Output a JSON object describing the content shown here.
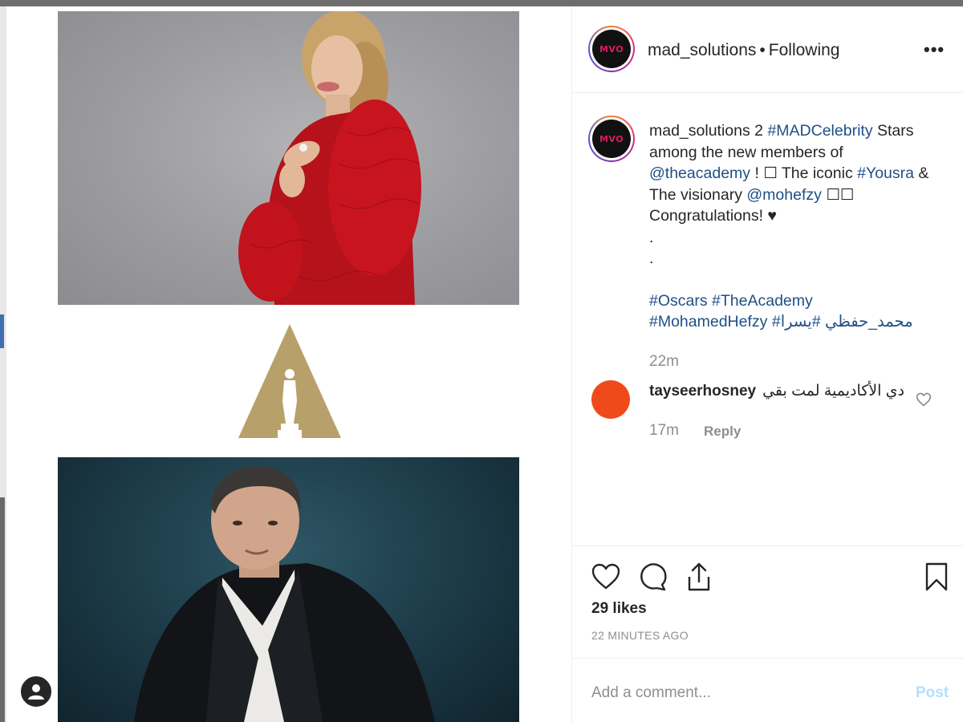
{
  "header": {
    "username": "mad_solutions",
    "separator": "•",
    "follow_status": "Following",
    "more": "•••",
    "avatar_text": "MVO"
  },
  "caption": {
    "username": "mad_solutions",
    "text_1": "2",
    "tag_1": "#MADCelebrity",
    "text_2": "Stars among the new members of",
    "mention_1": "@theacademy",
    "text_3": "! ☐ The iconic",
    "tag_2": "#Yousra",
    "text_4": "& The visionary",
    "mention_2": "@mohefzy",
    "text_5": "☐☐",
    "text_6": "Congratulations! ♥",
    "dot_1": ".",
    "dot_2": ".",
    "tag_3": "#Oscars",
    "tag_4": "#TheAcademy",
    "tag_5": "#MohamedHefzy",
    "tag_6": "#محمد_حفظي",
    "tag_7": "#يسرا",
    "time": "22m"
  },
  "comment": {
    "username": "tayseerhosney",
    "text": "دي الأكاديمية لمت بقي",
    "time": "17m",
    "reply_label": "Reply"
  },
  "actions": {
    "likes": "29 likes",
    "time_ago": "22 MINUTES AGO"
  },
  "comment_bar": {
    "placeholder": "Add a comment...",
    "post_label": "Post"
  },
  "colors": {
    "hashtag": "#1f4f86",
    "muted": "#8e8e8e",
    "post_disabled": "#b2dffc",
    "comment_avatar": "#f04a1a",
    "oscar_gold": "#b8a06a"
  }
}
